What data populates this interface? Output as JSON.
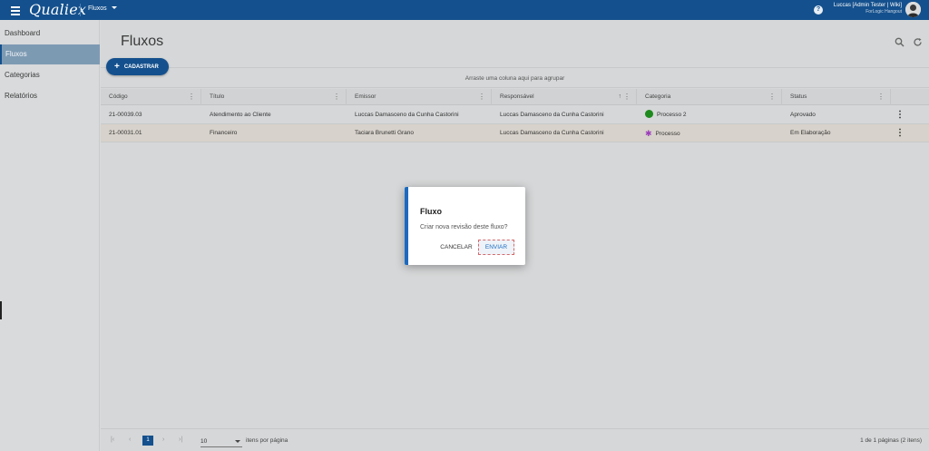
{
  "topbar": {
    "brand": "Qualiex",
    "module": "Fluxos",
    "help_icon": "help-icon",
    "user_name": "Luccas [Admin Tester | Wiki]",
    "user_org": "ForLogic Hangout"
  },
  "sidebar": {
    "items": [
      {
        "label": "Dashboard",
        "active": false
      },
      {
        "label": "Fluxos",
        "active": true
      },
      {
        "label": "Categorias",
        "active": false
      },
      {
        "label": "Relatórios",
        "active": false
      }
    ]
  },
  "main": {
    "title": "Fluxos",
    "add_button": "CADASTRAR",
    "group_hint": "Arraste uma coluna aqui para agrupar",
    "columns": [
      "Código",
      "Título",
      "Emissor",
      "Responsável",
      "Categoria",
      "Status"
    ],
    "rows": [
      {
        "codigo": "21-00039.03",
        "titulo": "Atendimento ao Cliente",
        "emissor": "Luccas Damasceno da Cunha Castorini",
        "responsavel": "Luccas Damasceno da Cunha Castorini",
        "categoria": "Processo 2",
        "status": "Aprovado"
      },
      {
        "codigo": "21-00031.01",
        "titulo": "Financeiro",
        "emissor": "Taciara Brunetti Grano",
        "responsavel": "Luccas Damasceno da Cunha Castorini",
        "categoria": "Processo",
        "status": "Em Elaboração"
      }
    ]
  },
  "pager": {
    "current_page": "1",
    "page_size": "10",
    "page_size_label": "itens por página",
    "info": "1 de 1 páginas (2 itens)"
  },
  "dialog": {
    "title": "Fluxo",
    "message": "Criar nova revisão deste fluxo?",
    "cancel": "CANCELAR",
    "confirm": "ENVIAR"
  },
  "colors": {
    "brand": "#14508d",
    "accent": "#1b6ac0",
    "category_green": "#1d8a1d",
    "category_purple": "#9b3dbb"
  }
}
